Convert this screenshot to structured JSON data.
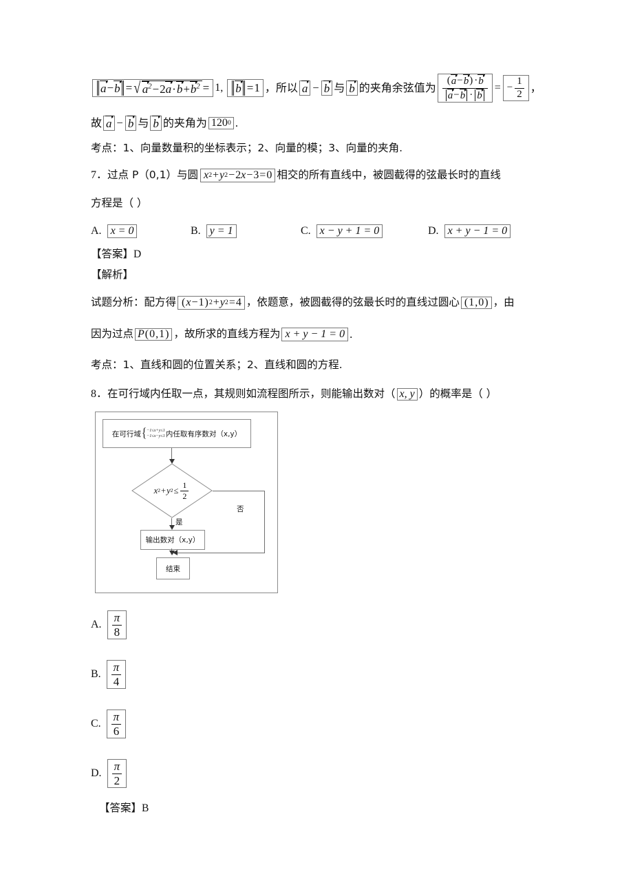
{
  "document": {
    "type": "math-exam-solution-page",
    "language": "zh-CN"
  },
  "q6_solution": {
    "line1": {
      "formula_norm_diff": "|a⃗ − b⃗| = √(a⃗² − 2a⃗·b⃗ + b⃗²)",
      "equals_one": "1,",
      "formula_norm_b": "|b⃗| = 1",
      "comma": "，",
      "text_so": "所以",
      "vec_a": "a⃗",
      "minus": "−",
      "vec_b1": "b⃗",
      "text_with": "与",
      "vec_b2": "b⃗",
      "text_cos_value": "的夹角余弦值为",
      "frac_num": "(a⃗ − b⃗)·b⃗",
      "frac_den": "|a⃗ − b⃗|·|b⃗|",
      "equals": "=",
      "result_sign": "−",
      "result_num": "1",
      "result_den": "2",
      "trailing_comma": "，"
    },
    "line2": {
      "text_so": "故",
      "vec_a": "a⃗",
      "minus": "−",
      "vec_b1": "b⃗",
      "text_with": "与",
      "vec_b2": "b⃗",
      "text_angle_is": "的夹角为",
      "angle": "120",
      "angle_sup": "0",
      "period": "."
    },
    "kaodian": "考点：1、向量数量积的坐标表示；2、向量的模；3、向量的夹角."
  },
  "q7": {
    "number": "7．",
    "stem_part1": "过点 P（0,1）与圆",
    "circle_equation": {
      "x": "x",
      "xsup": "2",
      "plus1": "+",
      "y": "y",
      "ysup": "2",
      "minus1": "−",
      "two": "2",
      "xvar": "x",
      "minus2": "−",
      "three": "3",
      "eq": "=",
      "zero": "0"
    },
    "stem_part2": "相交的所有直线中，被圆截得的弦最长时的直线",
    "stem_line2": "方程是（          ）",
    "options": [
      {
        "letter": "A.",
        "value": "x = 0"
      },
      {
        "letter": "B.",
        "value": "y = 1"
      },
      {
        "letter": "C.",
        "value": "x − y + 1 = 0"
      },
      {
        "letter": "D.",
        "value": "x + y − 1 = 0"
      }
    ],
    "answer_label": "【答案】",
    "answer_value": "D",
    "analysis_label": "【解析】",
    "analysis": {
      "prefix": "试题分析：配方得",
      "completed_square": "(x − 1)² + y² = 4",
      "mid1": "，依题意，被圆截得的弦最长时的直线过圆心",
      "center": "(1, 0)",
      "mid2": "，由",
      "line2_prefix": "因为过点",
      "point_p": "P(0,1)",
      "line2_mid": "，故所求的直线方程为",
      "final_equation": "x + y − 1 = 0",
      "period": "."
    },
    "kaodian": "考点：1、直线和圆的位置关系；2、直线和圆的方程."
  },
  "q8": {
    "number": "8．",
    "stem_part1": "在可行域内任取一点，其规则如流程图所示，则能输出数对（",
    "pair": "x, y",
    "stem_part2": "）的概率是（          ）",
    "flowchart": {
      "start_prefix": "在可行域",
      "system_row1": "−1≤x+y≤1",
      "system_row2": "−1≤x−y≤1",
      "start_suffix": "内任取有序数对（x,y）",
      "decision": {
        "lhs_x": "x",
        "lhs_xsup": "2",
        "plus": "+",
        "lhs_y": "y",
        "lhs_ysup": "2",
        "rel": "≤",
        "num": "1",
        "den": "2"
      },
      "yes_label": "是",
      "no_label": "否",
      "output_box": "输出数对（x,y）",
      "end_box": "结束"
    },
    "options": [
      {
        "letter": "A.",
        "num": "π",
        "den": "8"
      },
      {
        "letter": "B.",
        "num": "π",
        "den": "4"
      },
      {
        "letter": "C.",
        "num": "π",
        "den": "6"
      },
      {
        "letter": "D.",
        "num": "π",
        "den": "2"
      }
    ],
    "answer_label": "【答案】",
    "answer_value": "B"
  },
  "colors": {
    "text": "#111111",
    "box_border": "#777777",
    "flow_border": "#8a8a8a",
    "connector": "#6f6f6f"
  }
}
